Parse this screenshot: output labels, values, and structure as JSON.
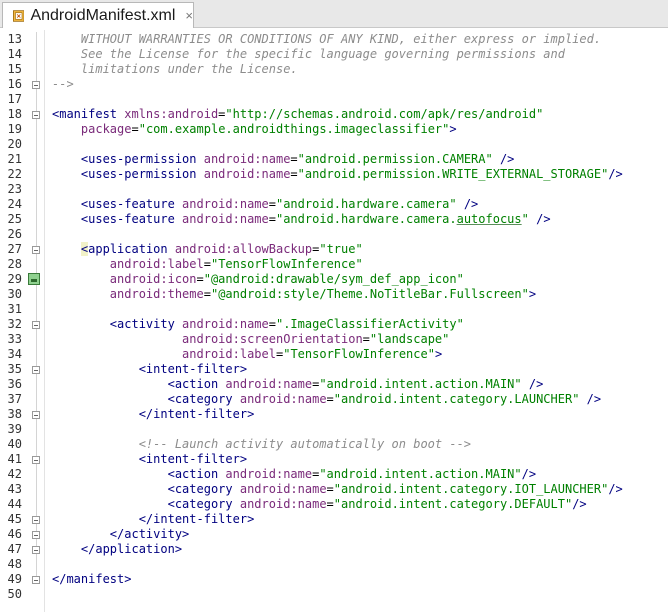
{
  "tab": {
    "title": "AndroidManifest.xml",
    "close_label": "×",
    "icon": "xml-file-icon"
  },
  "colors": {
    "tag": "#000080",
    "attribute": "#7a2a7a",
    "string": "#008000",
    "comment": "#8c8c8c"
  },
  "lines": [
    {
      "n": "13",
      "tokens": [
        {
          "t": "    WITHOUT WARRANTIES OR CONDITIONS OF ANY KIND, either express or implied.",
          "c": "cm"
        }
      ]
    },
    {
      "n": "14",
      "tokens": [
        {
          "t": "    See the License for the specific language governing permissions and",
          "c": "cm"
        }
      ]
    },
    {
      "n": "15",
      "tokens": [
        {
          "t": "    limitations under the License.",
          "c": "cm"
        }
      ]
    },
    {
      "n": "16",
      "tokens": [
        {
          "t": "-->",
          "c": "cm"
        }
      ]
    },
    {
      "n": "17",
      "tokens": []
    },
    {
      "n": "18",
      "tokens": [
        {
          "t": "<manifest ",
          "c": "tag"
        },
        {
          "t": "xmlns:android",
          "c": "attr"
        },
        {
          "t": "=",
          "c": "sym"
        },
        {
          "t": "\"http://schemas.android.com/apk/res/android\"",
          "c": "str"
        }
      ]
    },
    {
      "n": "19",
      "tokens": [
        {
          "t": "    package",
          "c": "attr"
        },
        {
          "t": "=",
          "c": "sym"
        },
        {
          "t": "\"com.example.androidthings.imageclassifier\"",
          "c": "str"
        },
        {
          "t": ">",
          "c": "tag"
        }
      ]
    },
    {
      "n": "20",
      "tokens": []
    },
    {
      "n": "21",
      "tokens": [
        {
          "t": "    <uses-permission ",
          "c": "tag"
        },
        {
          "t": "android",
          "c": "ns"
        },
        {
          "t": ":name",
          "c": "attr"
        },
        {
          "t": "=",
          "c": "sym"
        },
        {
          "t": "\"android.permission.CAMERA\"",
          "c": "str"
        },
        {
          "t": " />",
          "c": "tag"
        }
      ]
    },
    {
      "n": "22",
      "tokens": [
        {
          "t": "    <uses-permission ",
          "c": "tag"
        },
        {
          "t": "android",
          "c": "ns"
        },
        {
          "t": ":name",
          "c": "attr"
        },
        {
          "t": "=",
          "c": "sym"
        },
        {
          "t": "\"android.permission.WRITE_EXTERNAL_STORAGE\"",
          "c": "str"
        },
        {
          "t": "/>",
          "c": "tag"
        }
      ]
    },
    {
      "n": "23",
      "tokens": []
    },
    {
      "n": "24",
      "tokens": [
        {
          "t": "    <uses-feature ",
          "c": "tag"
        },
        {
          "t": "android",
          "c": "ns"
        },
        {
          "t": ":name",
          "c": "attr"
        },
        {
          "t": "=",
          "c": "sym"
        },
        {
          "t": "\"android.hardware.camera\"",
          "c": "str"
        },
        {
          "t": " />",
          "c": "tag"
        }
      ]
    },
    {
      "n": "25",
      "tokens": [
        {
          "t": "    <uses-feature ",
          "c": "tag"
        },
        {
          "t": "android",
          "c": "ns"
        },
        {
          "t": ":name",
          "c": "attr"
        },
        {
          "t": "=",
          "c": "sym"
        },
        {
          "t": "\"android.hardware.camera.",
          "c": "str"
        },
        {
          "t": "autofocus",
          "c": "str uline"
        },
        {
          "t": "\"",
          "c": "str"
        },
        {
          "t": " />",
          "c": "tag"
        }
      ]
    },
    {
      "n": "26",
      "tokens": []
    },
    {
      "n": "27",
      "tokens": [
        {
          "t": "    ",
          "c": "tag"
        },
        {
          "t": "<",
          "c": "tag hl"
        },
        {
          "t": "application ",
          "c": "tag"
        },
        {
          "t": "android",
          "c": "ns"
        },
        {
          "t": ":allowBackup",
          "c": "attr"
        },
        {
          "t": "=",
          "c": "sym"
        },
        {
          "t": "\"true\"",
          "c": "str"
        }
      ]
    },
    {
      "n": "28",
      "tokens": [
        {
          "t": "        android",
          "c": "ns"
        },
        {
          "t": ":label",
          "c": "attr"
        },
        {
          "t": "=",
          "c": "sym"
        },
        {
          "t": "\"TensorFlowInference\"",
          "c": "str"
        }
      ]
    },
    {
      "n": "29",
      "tokens": [
        {
          "t": "        android",
          "c": "ns"
        },
        {
          "t": ":icon",
          "c": "attr"
        },
        {
          "t": "=",
          "c": "sym"
        },
        {
          "t": "\"@android:drawable/sym_def_app_icon\"",
          "c": "str"
        }
      ]
    },
    {
      "n": "30",
      "tokens": [
        {
          "t": "        android",
          "c": "ns"
        },
        {
          "t": ":theme",
          "c": "attr"
        },
        {
          "t": "=",
          "c": "sym"
        },
        {
          "t": "\"@android:style/Theme.NoTitleBar.Fullscreen\"",
          "c": "str"
        },
        {
          "t": ">",
          "c": "tag"
        }
      ]
    },
    {
      "n": "31",
      "tokens": []
    },
    {
      "n": "32",
      "tokens": [
        {
          "t": "        <activity ",
          "c": "tag"
        },
        {
          "t": "android",
          "c": "ns"
        },
        {
          "t": ":name",
          "c": "attr"
        },
        {
          "t": "=",
          "c": "sym"
        },
        {
          "t": "\".ImageClassifierActivity\"",
          "c": "str"
        }
      ]
    },
    {
      "n": "33",
      "tokens": [
        {
          "t": "                  android",
          "c": "ns"
        },
        {
          "t": ":screenOrientation",
          "c": "attr"
        },
        {
          "t": "=",
          "c": "sym"
        },
        {
          "t": "\"landscape\"",
          "c": "str"
        }
      ]
    },
    {
      "n": "34",
      "tokens": [
        {
          "t": "                  android",
          "c": "ns"
        },
        {
          "t": ":label",
          "c": "attr"
        },
        {
          "t": "=",
          "c": "sym"
        },
        {
          "t": "\"TensorFlowInference\"",
          "c": "str"
        },
        {
          "t": ">",
          "c": "tag"
        }
      ]
    },
    {
      "n": "35",
      "tokens": [
        {
          "t": "            <intent-filter>",
          "c": "tag"
        }
      ]
    },
    {
      "n": "36",
      "tokens": [
        {
          "t": "                <action ",
          "c": "tag"
        },
        {
          "t": "android",
          "c": "ns"
        },
        {
          "t": ":name",
          "c": "attr"
        },
        {
          "t": "=",
          "c": "sym"
        },
        {
          "t": "\"android.intent.action.MAIN\"",
          "c": "str"
        },
        {
          "t": " />",
          "c": "tag"
        }
      ]
    },
    {
      "n": "37",
      "tokens": [
        {
          "t": "                <category ",
          "c": "tag"
        },
        {
          "t": "android",
          "c": "ns"
        },
        {
          "t": ":name",
          "c": "attr"
        },
        {
          "t": "=",
          "c": "sym"
        },
        {
          "t": "\"android.intent.category.LAUNCHER\"",
          "c": "str"
        },
        {
          "t": " />",
          "c": "tag"
        }
      ]
    },
    {
      "n": "38",
      "tokens": [
        {
          "t": "            </intent-filter>",
          "c": "tag"
        }
      ]
    },
    {
      "n": "39",
      "tokens": []
    },
    {
      "n": "40",
      "tokens": [
        {
          "t": "            <!-- Launch activity automatically on boot -->",
          "c": "cm"
        }
      ]
    },
    {
      "n": "41",
      "tokens": [
        {
          "t": "            <intent-filter>",
          "c": "tag"
        }
      ]
    },
    {
      "n": "42",
      "tokens": [
        {
          "t": "                <action ",
          "c": "tag"
        },
        {
          "t": "android",
          "c": "ns"
        },
        {
          "t": ":name",
          "c": "attr"
        },
        {
          "t": "=",
          "c": "sym"
        },
        {
          "t": "\"android.intent.action.MAIN\"",
          "c": "str"
        },
        {
          "t": "/>",
          "c": "tag"
        }
      ]
    },
    {
      "n": "43",
      "tokens": [
        {
          "t": "                <category ",
          "c": "tag"
        },
        {
          "t": "android",
          "c": "ns"
        },
        {
          "t": ":name",
          "c": "attr"
        },
        {
          "t": "=",
          "c": "sym"
        },
        {
          "t": "\"android.intent.category.IOT_LAUNCHER\"",
          "c": "str"
        },
        {
          "t": "/>",
          "c": "tag"
        }
      ]
    },
    {
      "n": "44",
      "tokens": [
        {
          "t": "                <category ",
          "c": "tag"
        },
        {
          "t": "android",
          "c": "ns"
        },
        {
          "t": ":name",
          "c": "attr"
        },
        {
          "t": "=",
          "c": "sym"
        },
        {
          "t": "\"android.intent.category.DEFAULT\"",
          "c": "str"
        },
        {
          "t": "/>",
          "c": "tag"
        }
      ]
    },
    {
      "n": "45",
      "tokens": [
        {
          "t": "            </intent-filter>",
          "c": "tag"
        }
      ]
    },
    {
      "n": "46",
      "tokens": [
        {
          "t": "        </activity>",
          "c": "tag"
        }
      ]
    },
    {
      "n": "47",
      "tokens": [
        {
          "t": "    </application>",
          "c": "tag"
        }
      ]
    },
    {
      "n": "48",
      "tokens": []
    },
    {
      "n": "49",
      "tokens": [
        {
          "t": "</manifest>",
          "c": "tag"
        }
      ]
    },
    {
      "n": "50",
      "tokens": []
    }
  ],
  "gutter_markers": [
    {
      "line": "16",
      "icon": "fold-end-icon"
    },
    {
      "line": "18",
      "icon": "fold-start-icon"
    },
    {
      "line": "27",
      "icon": "fold-start-icon"
    },
    {
      "line": "29",
      "icon": "app-icon"
    },
    {
      "line": "32",
      "icon": "fold-start-icon"
    },
    {
      "line": "35",
      "icon": "fold-start-icon"
    },
    {
      "line": "38",
      "icon": "fold-end-icon"
    },
    {
      "line": "41",
      "icon": "fold-start-icon"
    },
    {
      "line": "45",
      "icon": "fold-end-icon"
    },
    {
      "line": "46",
      "icon": "fold-end-icon"
    },
    {
      "line": "47",
      "icon": "fold-end-icon"
    },
    {
      "line": "49",
      "icon": "fold-end-icon"
    }
  ]
}
